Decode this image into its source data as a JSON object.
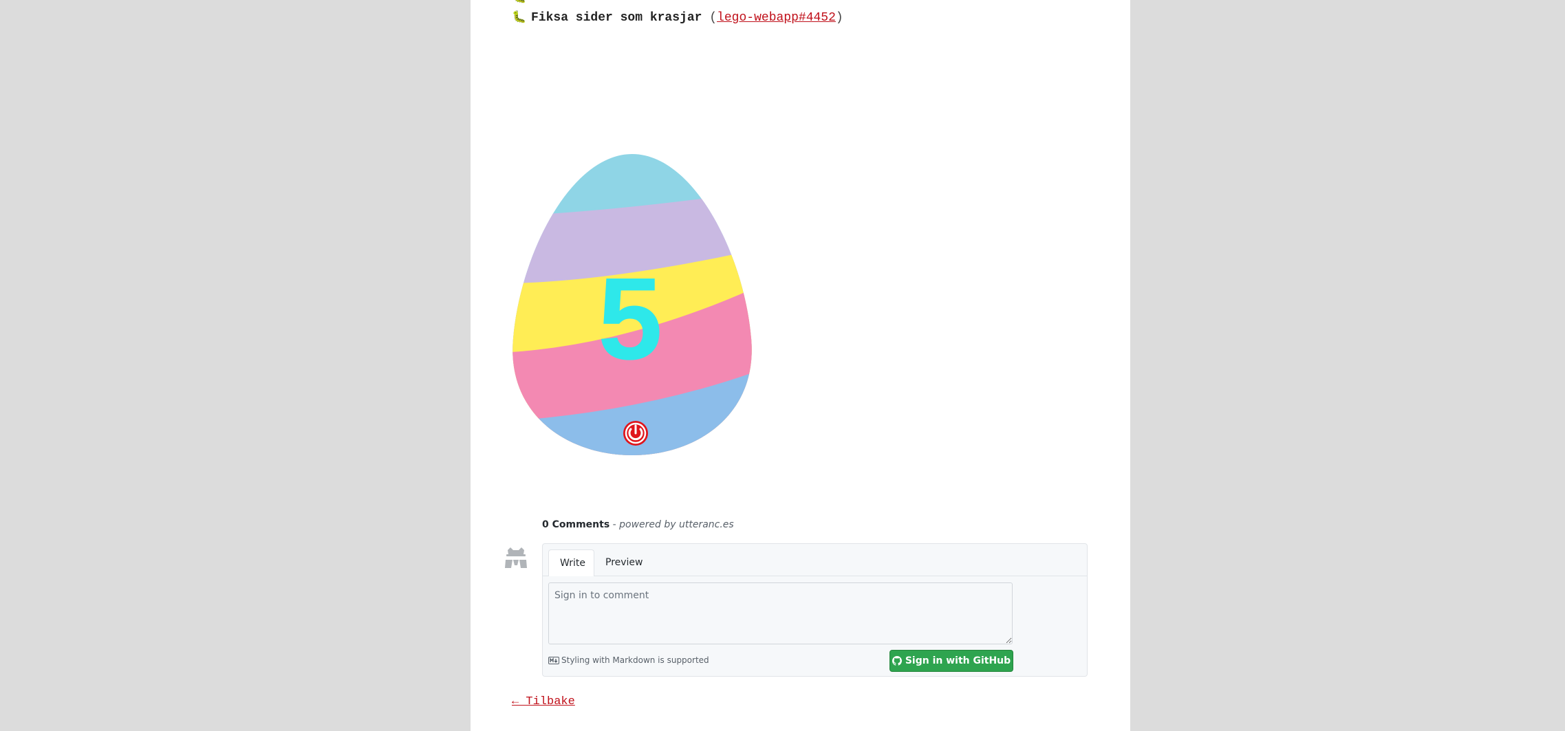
{
  "changelog": {
    "items": [
      {
        "icon": "bug-icon",
        "emoji": "🐛",
        "label": "Fiksa sider som krasjar",
        "open_paren": "(",
        "link": "lego-webapp#4452",
        "close_paren": ")"
      }
    ]
  },
  "easter_egg": {
    "number": "5",
    "stripe_colors": [
      "#8fd5e6",
      "#c9b9e2",
      "#ffed55",
      "#f389b2",
      "#8cbdea"
    ],
    "number_color": "#2ee8ea",
    "logo_color": "#e0151c"
  },
  "comments": {
    "count_label": "0 Comments",
    "separator": " - ",
    "powered_by": "powered by utteranc.es",
    "tabs": [
      "Write",
      "Preview"
    ],
    "textarea_placeholder": "Sign in to comment",
    "markdown_note": "Styling with Markdown is supported",
    "sign_in_label": "Sign in with GitHub",
    "button_color": "#2ea44f"
  },
  "back_link": "← Tilbake"
}
